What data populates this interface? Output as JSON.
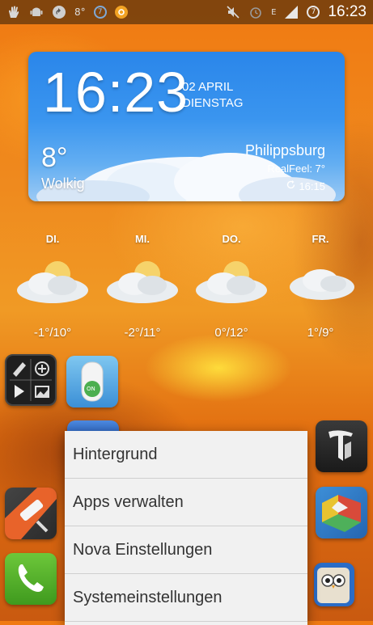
{
  "status_bar": {
    "left_icons": [
      "hand-icon",
      "android-icon",
      "sync-icon",
      "number-icon",
      "seven-circle-icon",
      "app-circle-icon"
    ],
    "number_label": "8°",
    "circle7_label": "7",
    "right_icons": [
      "mute-icon",
      "alarm-icon",
      "network-e-icon",
      "signal-icon",
      "battery-icon"
    ],
    "network_label": "E",
    "battery_label": "7",
    "time": "16:23"
  },
  "clock_widget": {
    "time": "16:23",
    "date_line1": "02 APRIL",
    "date_line2": "DIENSTAG",
    "temperature": "8°",
    "condition": "Wolkig",
    "city": "Philippsburg",
    "realfeel": "RealFeel: 7°",
    "updated": "16:15",
    "accent": "#2a86ea"
  },
  "forecast": [
    {
      "day": "DI.",
      "range": "-1°/10°",
      "icon": "partly-cloudy-icon"
    },
    {
      "day": "MI.",
      "range": "-2°/11°",
      "icon": "partly-cloudy-icon"
    },
    {
      "day": "DO.",
      "range": "0°/12°",
      "icon": "partly-cloudy-icon"
    },
    {
      "day": "FR.",
      "range": "1°/9°",
      "icon": "cloudy-icon"
    }
  ],
  "toggle_label": "ON",
  "apps": [
    "media-editor-app",
    "toggle-app",
    "paint-roller-app",
    "phone-app",
    "nyt-app",
    "puzzle-app",
    "owl-app"
  ],
  "context_menu": {
    "items": [
      "Hintergrund",
      "Apps verwalten",
      "Nova Einstellungen",
      "Systemeinstellungen"
    ]
  }
}
